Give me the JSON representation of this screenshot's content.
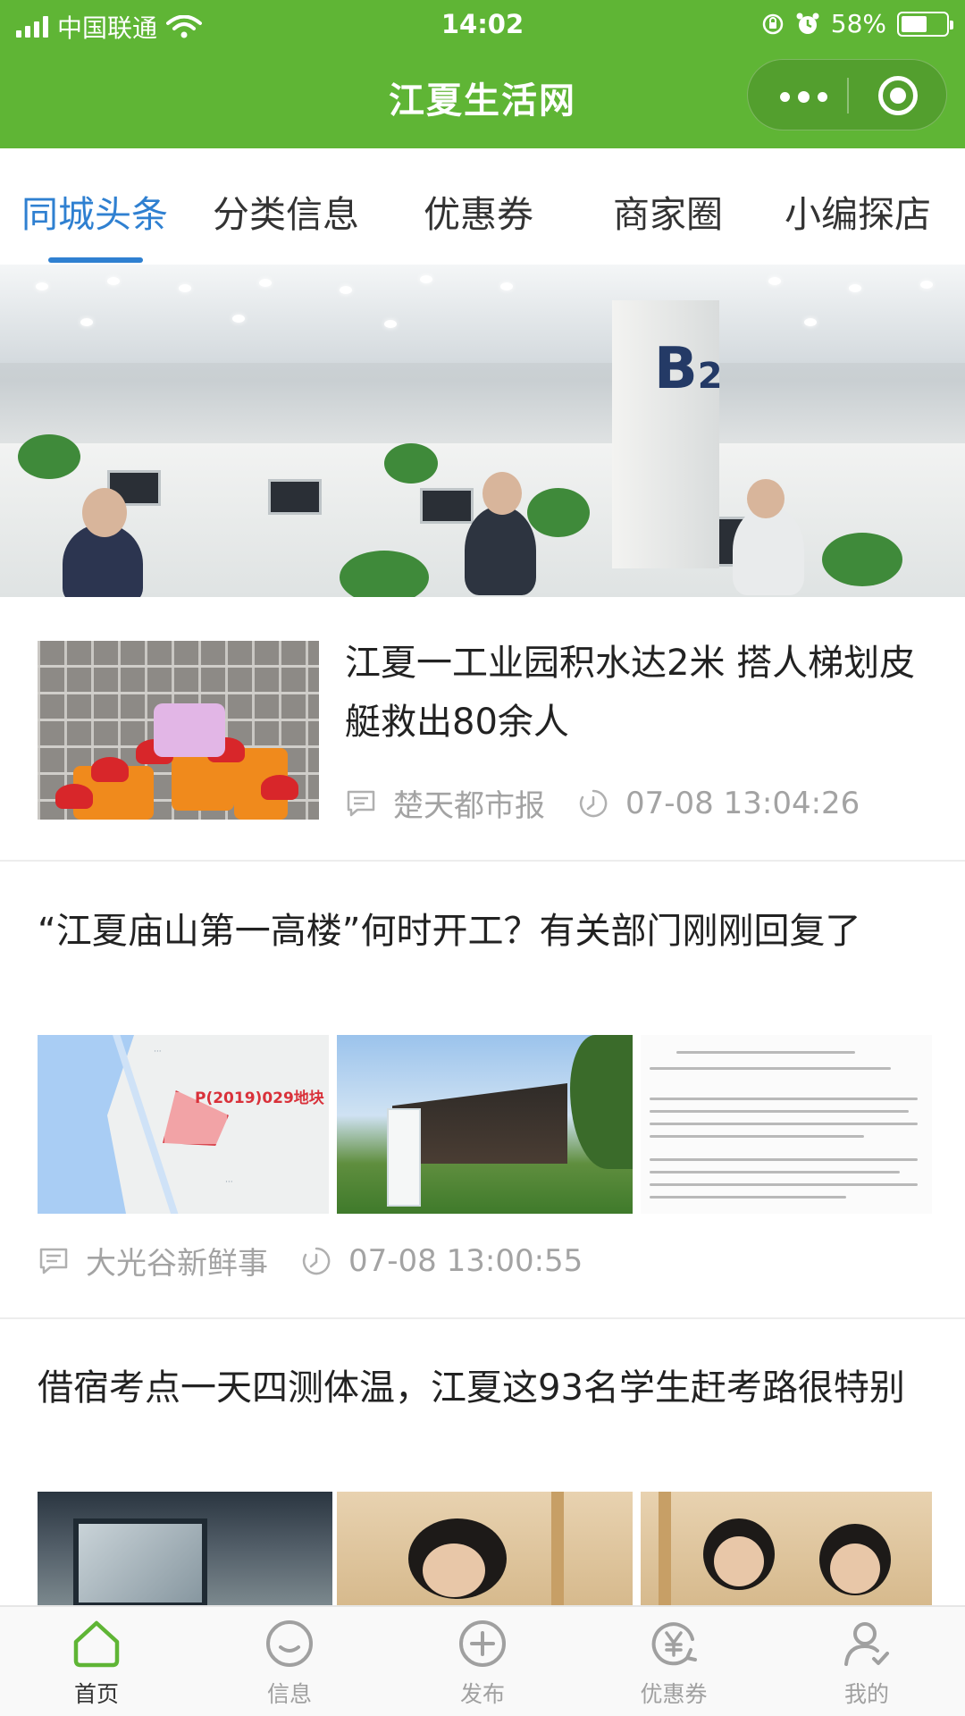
{
  "status_bar": {
    "carrier": "中国联通",
    "time": "14:02",
    "battery": "58%",
    "battery_level": 0.58
  },
  "header": {
    "title": "江夏生活网"
  },
  "tabs": [
    {
      "label": "同城头条",
      "active": true
    },
    {
      "label": "分类信息",
      "active": false
    },
    {
      "label": "优惠券",
      "active": false
    },
    {
      "label": "商家圈",
      "active": false
    },
    {
      "label": "小编探店",
      "active": false
    }
  ],
  "banner": {
    "slide_count": 5,
    "active_index": 0
  },
  "articles": [
    {
      "title": "江夏一工业园积水达2米 搭人梯划皮艇救出80余人",
      "source": "楚天都市报",
      "time": "07-08 13:04:26"
    },
    {
      "title": "“江夏庙山第一高楼”何时开工？有关部门刚刚回复了",
      "map_label": "P(2019)029地块",
      "source": "大光谷新鲜事",
      "time": "07-08 13:00:55"
    },
    {
      "title": "借宿考点一天四测体温，江夏这93名学生赶考路很特别"
    }
  ],
  "bottom_nav": [
    {
      "label": "首页",
      "icon": "home-icon",
      "active": true
    },
    {
      "label": "信息",
      "icon": "smile-icon",
      "active": false
    },
    {
      "label": "发布",
      "icon": "plus-circle-icon",
      "active": false
    },
    {
      "label": "优惠券",
      "icon": "yen-coupon-icon",
      "active": false
    },
    {
      "label": "我的",
      "icon": "user-icon",
      "active": false
    }
  ],
  "colors": {
    "brand_green": "#5fb535",
    "tab_active_blue": "#2f80d1",
    "meta_gray": "#a3a3a3"
  }
}
